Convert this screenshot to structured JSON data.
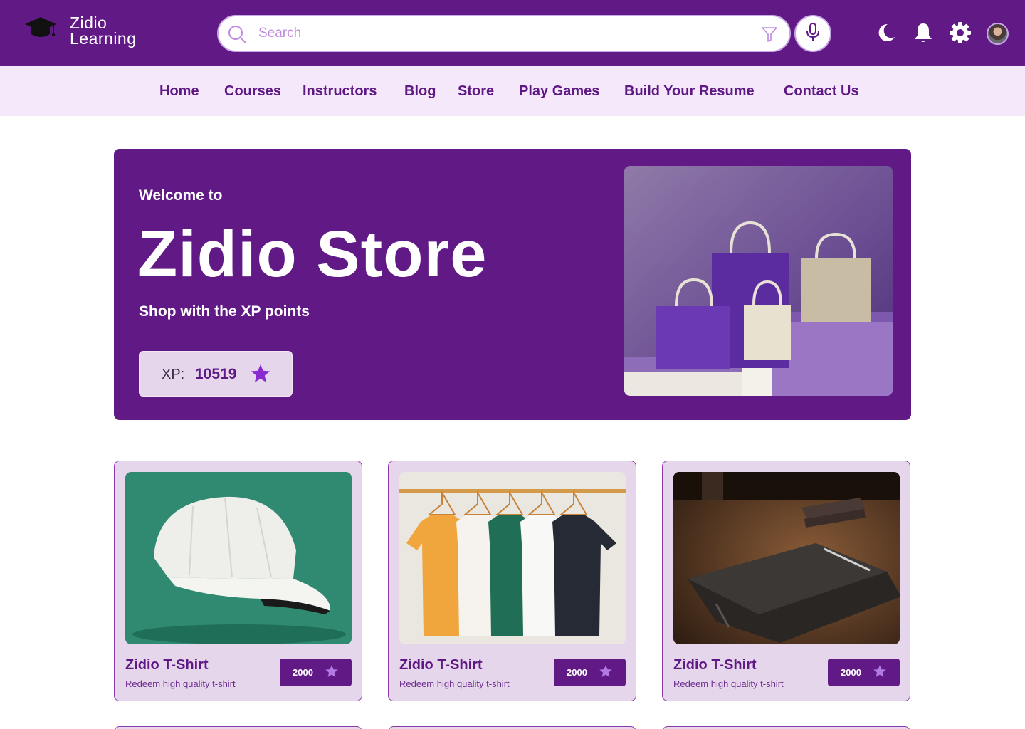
{
  "brand": {
    "line1": "Zidio",
    "line2": "Learning"
  },
  "search": {
    "placeholder": "Search"
  },
  "nav": {
    "items": [
      {
        "label": "Home"
      },
      {
        "label": "Courses"
      },
      {
        "label": "Instructors"
      },
      {
        "label": "Blog"
      },
      {
        "label": "Store"
      },
      {
        "label": "Play Games"
      },
      {
        "label": "Build Your Resume"
      },
      {
        "label": "Contact Us"
      }
    ]
  },
  "hero": {
    "welcome": "Welcome to",
    "title": "Zidio Store",
    "subtitle": "Shop with the XP points",
    "xp_label": "XP:",
    "xp_value": "10519"
  },
  "products": [
    {
      "name": "Zidio T-Shirt",
      "description": "Redeem high quality t-shirt",
      "price": "2000",
      "image": "white-cap"
    },
    {
      "name": "Zidio T-Shirt",
      "description": "Redeem high quality t-shirt",
      "price": "2000",
      "image": "tshirts-on-rack"
    },
    {
      "name": "Zidio T-Shirt",
      "description": "Redeem high quality t-shirt",
      "price": "2000",
      "image": "notebook-on-desk"
    }
  ],
  "colors": {
    "primary": "#611a85",
    "nav_bg": "#f6e8fb",
    "card_bg": "#e6d6ec",
    "star": "#8a2bd1"
  },
  "icons": [
    "graduation-cap-icon",
    "search-icon",
    "filter-icon",
    "microphone-icon",
    "moon-icon",
    "bell-icon",
    "gear-icon",
    "star-icon"
  ]
}
